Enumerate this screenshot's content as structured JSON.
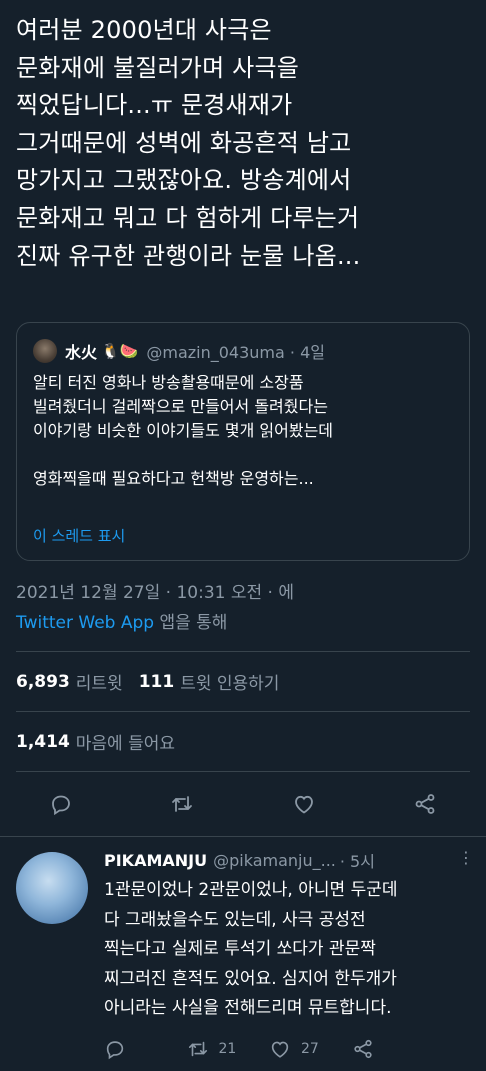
{
  "tweet": {
    "text": "여러분 2000년대 사극은\n문화재에 불질러가며 사극을\n찍었답니다...ㅠ 문경새재가\n그거때문에 성벽에 화공흔적 남고\n망가지고 그랬잖아요. 방송계에서\n문화재고 뭐고 다 험하게 다루는거\n진짜 유구한 관행이라 눈물 나옴..."
  },
  "quote": {
    "name": "水火",
    "emoji": "🐧🍉",
    "handle": "@mazin_043uma · 4일",
    "body": "알티 터진 영화나 방송촬용때문에 소장품\n빌려줬더니 걸레짝으로 만들어서 돌려줬다는\n이야기랑 비슷한 이야기들도 몇개 읽어봤는데\n\n영화찍을때 필요하다고 헌책방 운영하는...",
    "thread_link": "이 스레드 표시"
  },
  "meta": {
    "timestamp": "2021년 12월 27일 · 10:31 오전 · 에",
    "app": "Twitter Web App",
    "via_suffix": " 앱을 통해"
  },
  "stats": {
    "retweets": "6,893",
    "retweets_label": "리트윗",
    "quotes": "111",
    "quotes_label": "트윗 인용하기",
    "likes": "1,414",
    "likes_label": "마음에 들어요"
  },
  "reply": {
    "name": "PIKAMANJU",
    "handle": "@pikamanju_...",
    "time": "· 5시",
    "more": "⋮",
    "body": "1관문이었나 2관문이었나, 아니면 두군데\n다 그래놨을수도 있는데, 사극 공성전\n찍는다고 실제로 투석기 쏘다가 관문짝\n찌그러진 흔적도 있어요. 심지어 한두개가\n아니라는 사실을 전해드리며 뮤트합니다.",
    "retweets": "21",
    "likes": "27"
  },
  "colors": {
    "background": "#15202b",
    "accent": "#1d9bf0",
    "muted": "#8b98a5",
    "border": "#38444d"
  }
}
